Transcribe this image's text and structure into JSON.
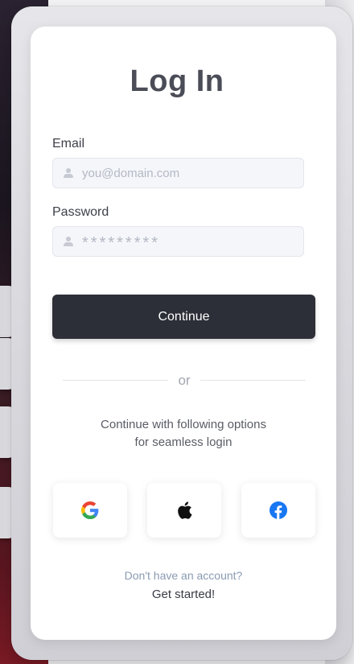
{
  "title": "Log In",
  "email": {
    "label": "Email",
    "placeholder": "you@domain.com",
    "icon": "user-icon"
  },
  "password": {
    "label": "Password",
    "placeholder": "*********",
    "icon": "user-icon"
  },
  "continue_label": "Continue",
  "divider_text": "or",
  "options_text": {
    "line1": "Continue with following options",
    "line2": "for seamless login"
  },
  "social": [
    {
      "name": "google",
      "icon": "google-icon"
    },
    {
      "name": "apple",
      "icon": "apple-icon"
    },
    {
      "name": "facebook",
      "icon": "facebook-icon"
    }
  ],
  "footer": {
    "prompt": "Don't have an account?",
    "link": "Get started!"
  },
  "colors": {
    "button_bg": "#2c2f37",
    "title": "#4a4c57",
    "link_muted": "#8a9bb3",
    "facebook": "#1877f2"
  }
}
